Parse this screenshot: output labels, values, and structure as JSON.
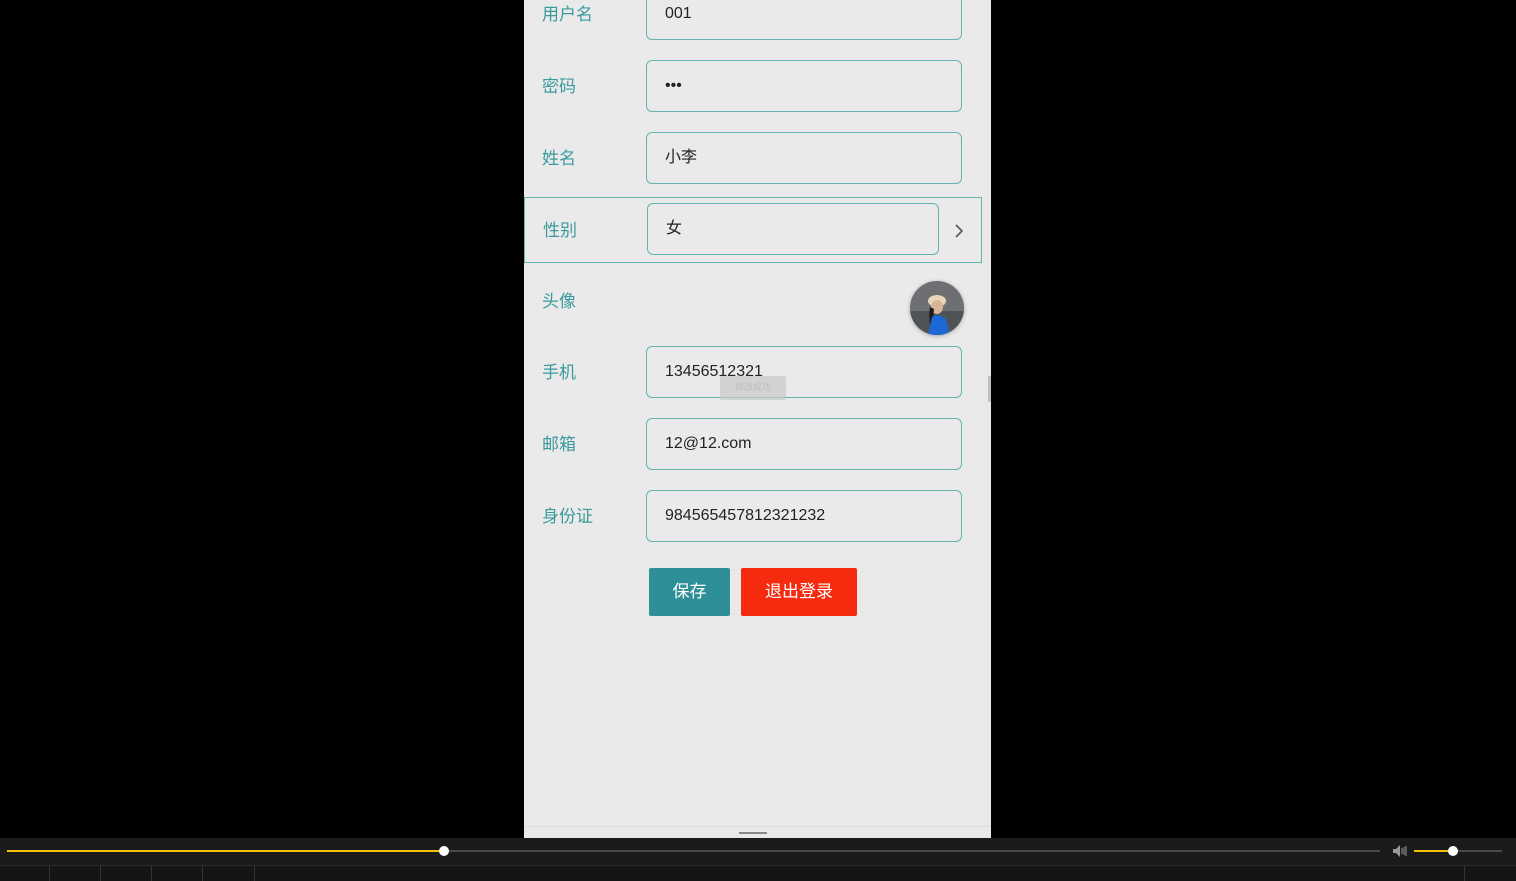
{
  "profile": {
    "fields": [
      {
        "label": "用户名",
        "value": "001"
      },
      {
        "label": "密码",
        "value": "•••"
      },
      {
        "label": "姓名",
        "value": "小李"
      },
      {
        "label": "性别",
        "value": "女"
      },
      {
        "label": "头像",
        "value": ""
      },
      {
        "label": "手机",
        "value": "13456512321"
      },
      {
        "label": "邮箱",
        "value": "12@12.com"
      },
      {
        "label": "身份证",
        "value": "984565457812321232"
      }
    ],
    "save_label": "保存",
    "logout_label": "退出登录",
    "toast": "修改成功"
  },
  "colors": {
    "accent": "#2f8f98",
    "danger": "#f52a0e",
    "label": "#3b9a9e",
    "border": "#63b3af",
    "progress": "#f2c200"
  },
  "player": {
    "progress": 0.318,
    "volume": 0.44
  },
  "icons": [
    "chevron-right-icon",
    "avatar-image",
    "volume-icon"
  ]
}
